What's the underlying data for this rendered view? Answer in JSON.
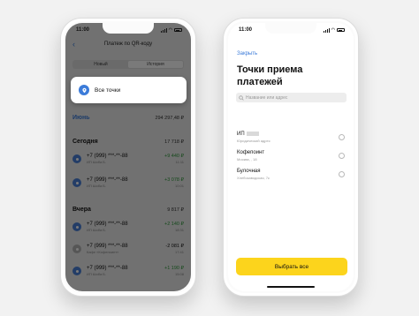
{
  "left_phone": {
    "status": {
      "time": "11:00"
    },
    "nav": {
      "back": "‹",
      "title": "Платеж по QR-коду"
    },
    "tabs": [
      "Новый",
      "История"
    ],
    "popup": {
      "label": "Все точки"
    },
    "month": {
      "label": "Июнь",
      "value": "294 297,48 ₽"
    },
    "today": {
      "label": "Сегодня",
      "value": "17 718 ₽"
    },
    "yesterday": {
      "label": "Вчера",
      "value": "9 817 ₽"
    },
    "transactions": [
      {
        "name": "+7 (999) ***-**-88",
        "sub": "ИП Шоба Б.",
        "amount": "+9 440 ₽",
        "time": "11:11"
      },
      {
        "name": "+7 (999) ***-**-88",
        "sub": "ИП Шоба Б.",
        "amount": "+3 078 ₽",
        "time": "10:01"
      },
      {
        "name": "+7 (999) ***-**-88",
        "sub": "ИП Шоба Б.",
        "amount": "+2 140 ₽",
        "time": "18:31"
      },
      {
        "name": "+7 (999) ***-**-88",
        "sub": "Кафе «Кофепоинт»",
        "amount": "-2 081 ₽",
        "time": "17:41"
      },
      {
        "name": "+7 (999) ***-**-88",
        "sub": "ИП Шоба Б.",
        "amount": "+1 190 ₽",
        "time": "15:08"
      }
    ]
  },
  "right_phone": {
    "status": {
      "time": "11:00"
    },
    "close": "Закрыть",
    "title_line1": "Точки приема",
    "title_line2": "платежей",
    "search": {
      "placeholder": "Название или адрес"
    },
    "points": [
      {
        "name": "ИП",
        "address": "Юридический адрес"
      },
      {
        "name": "Кофепоинт",
        "address": "Москва, , 18"
      },
      {
        "name": "Булочная",
        "address": "Хлебозаводская, 7к"
      }
    ],
    "select_button": "Выбрать все"
  },
  "colors": {
    "accent": "#3b7bd9",
    "button": "#fcd41c",
    "positive": "#2f9a3b"
  }
}
